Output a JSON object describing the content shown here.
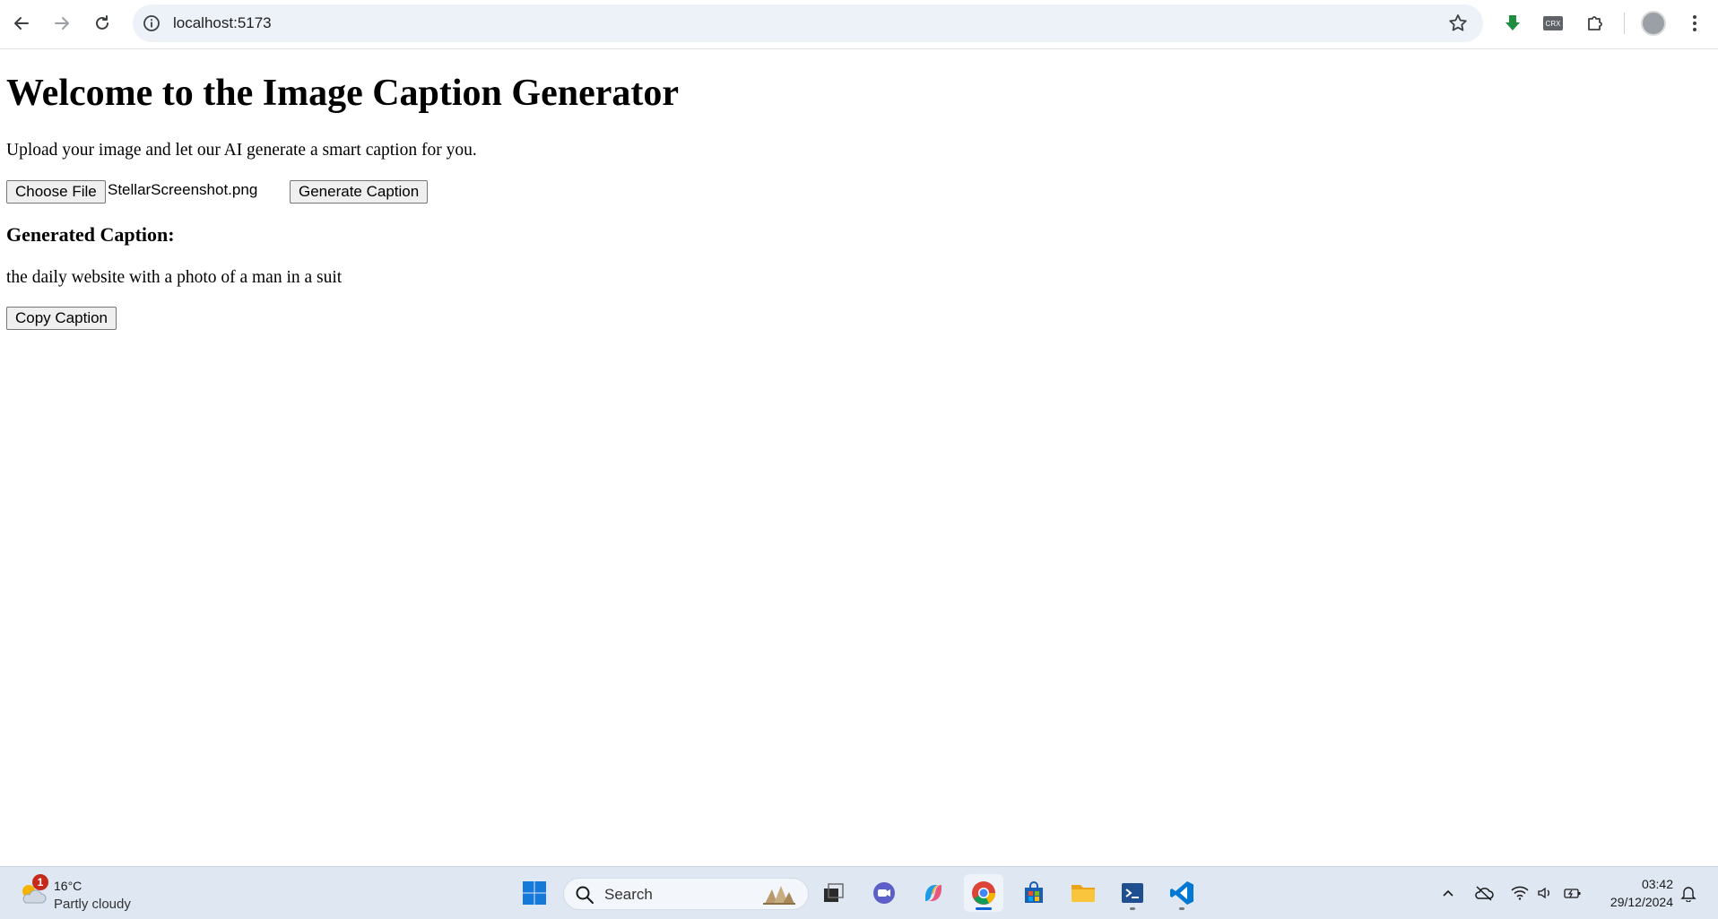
{
  "browser": {
    "url": "localhost:5173"
  },
  "page": {
    "title": "Welcome to the Image Caption Generator",
    "intro": "Upload your image and let our AI generate a smart caption for you.",
    "choose_file_label": "Choose File",
    "file_name": "StellarScreenshot.png",
    "generate_label": "Generate Caption",
    "caption_heading": "Generated Caption:",
    "caption_text": "the daily website with a photo of a man in a suit",
    "copy_label": "Copy Caption"
  },
  "taskbar": {
    "weather": {
      "badge": "1",
      "temp": "16°C",
      "condition": "Partly cloudy"
    },
    "search_label": "Search",
    "time": "03:42",
    "date": "29/12/2024"
  },
  "colors": {
    "accent_blue": "#0a62d6",
    "download_green": "#1e8e3e",
    "badge_red": "#c42b1c"
  }
}
